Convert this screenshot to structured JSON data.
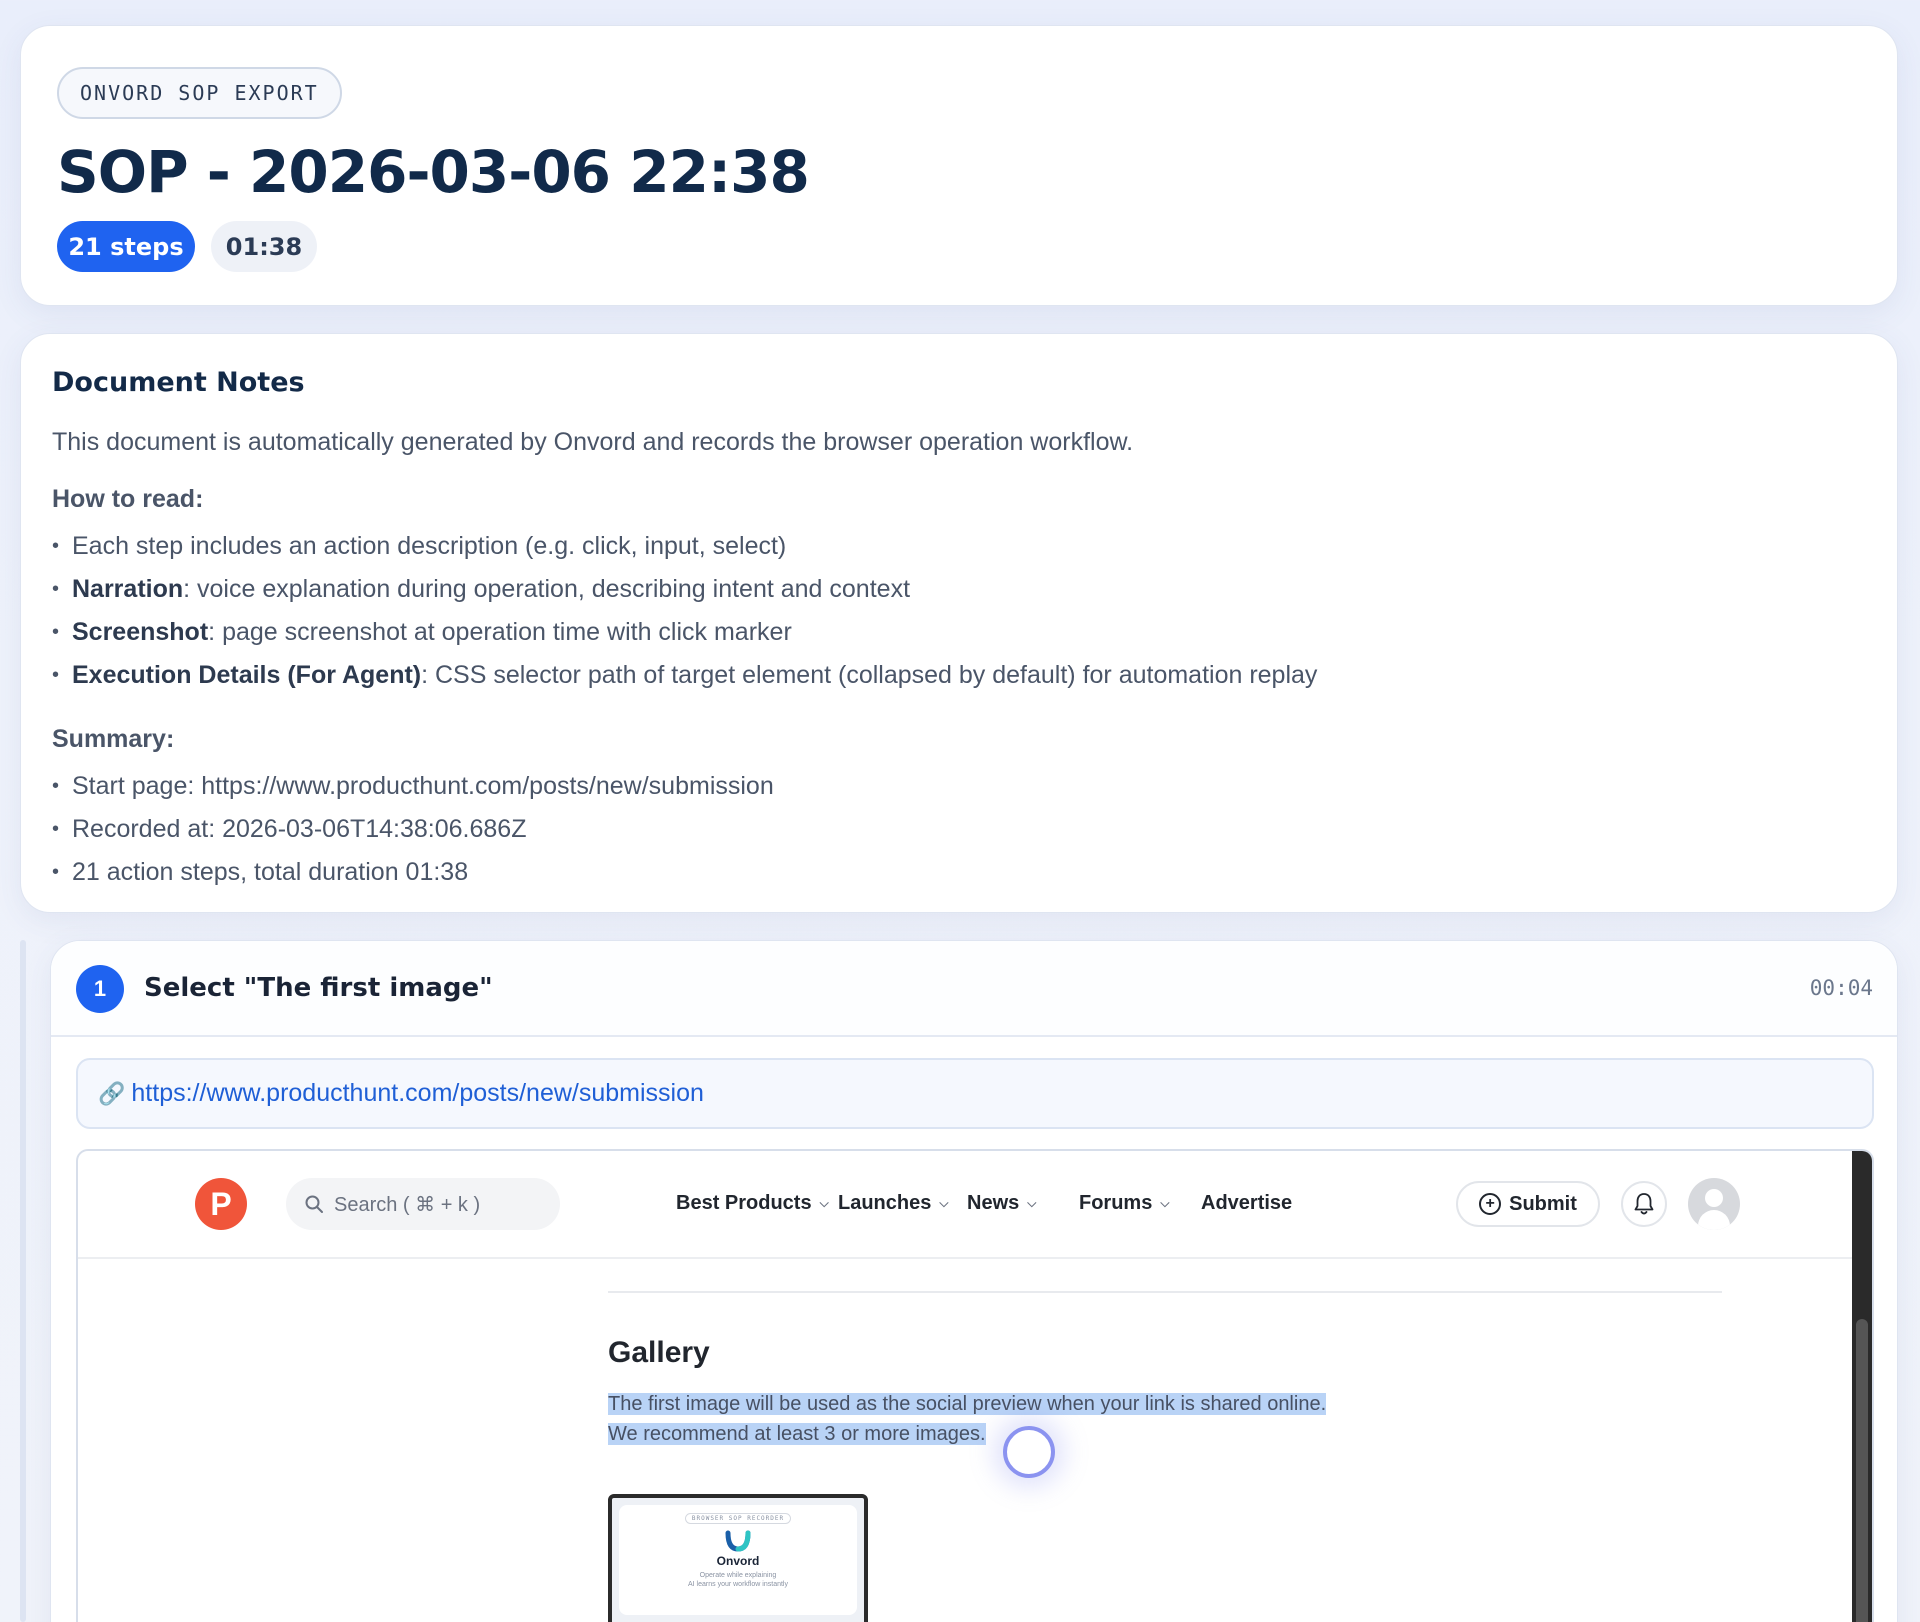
{
  "header": {
    "eyebrow": "ONVORD SOP EXPORT",
    "title": "SOP - 2026-03-06 22:38",
    "steps_badge": "21 steps",
    "duration_badge": "01:38"
  },
  "notes": {
    "title": "Document Notes",
    "intro": "This document is automatically generated by Onvord and records the browser operation workflow.",
    "how_title": "How to read:",
    "how_items": [
      {
        "text": "Each step includes an action description (e.g. click, input, select)"
      },
      {
        "bold": "Narration",
        "text": ": voice explanation during operation, describing intent and context"
      },
      {
        "bold": "Screenshot",
        "text": ": page screenshot at operation time with click marker"
      },
      {
        "bold": "Execution Details (For Agent)",
        "text": ": CSS selector path of target element (collapsed by default) for automation replay"
      }
    ],
    "summary_title": "Summary:",
    "summary_items": [
      "Start page: https://www.producthunt.com/posts/new/submission",
      "Recorded at: 2026-03-06T14:38:06.686Z",
      "21 action steps, total duration 01:38"
    ]
  },
  "step": {
    "number": "1",
    "title": "Select \"The first image\"",
    "time": "00:04",
    "url_icon": "🔗",
    "url": "https://www.producthunt.com/posts/new/submission",
    "screenshot": {
      "logo_letter": "P",
      "search_placeholder": "Search ( ⌘ + k )",
      "nav": [
        "Best Products",
        "Launches",
        "News",
        "Forums",
        "Advertise"
      ],
      "submit_label": "Submit",
      "gallery_title": "Gallery",
      "gallery_line1": "The first image will be used as the social preview when your link is shared online.",
      "gallery_line2": "We recommend at least 3 or more images.",
      "thumb_tag": "BROWSER SOP RECORDER",
      "thumb_name": "Onvord",
      "thumb_line1": "Operate while explaining",
      "thumb_line2": "AI learns your workflow instantly"
    }
  },
  "colors": {
    "accent": "#1f63f0",
    "title": "#112a4a",
    "link": "#1f5fd6",
    "producthunt": "#f0553a",
    "highlight": "#b9d3f6",
    "cursor": "#8b93f0"
  },
  "icons": {
    "url": "link-icon",
    "search": "search-icon",
    "bell": "bell-icon",
    "submit": "plus-circle-icon",
    "avatar": "avatar-icon"
  }
}
